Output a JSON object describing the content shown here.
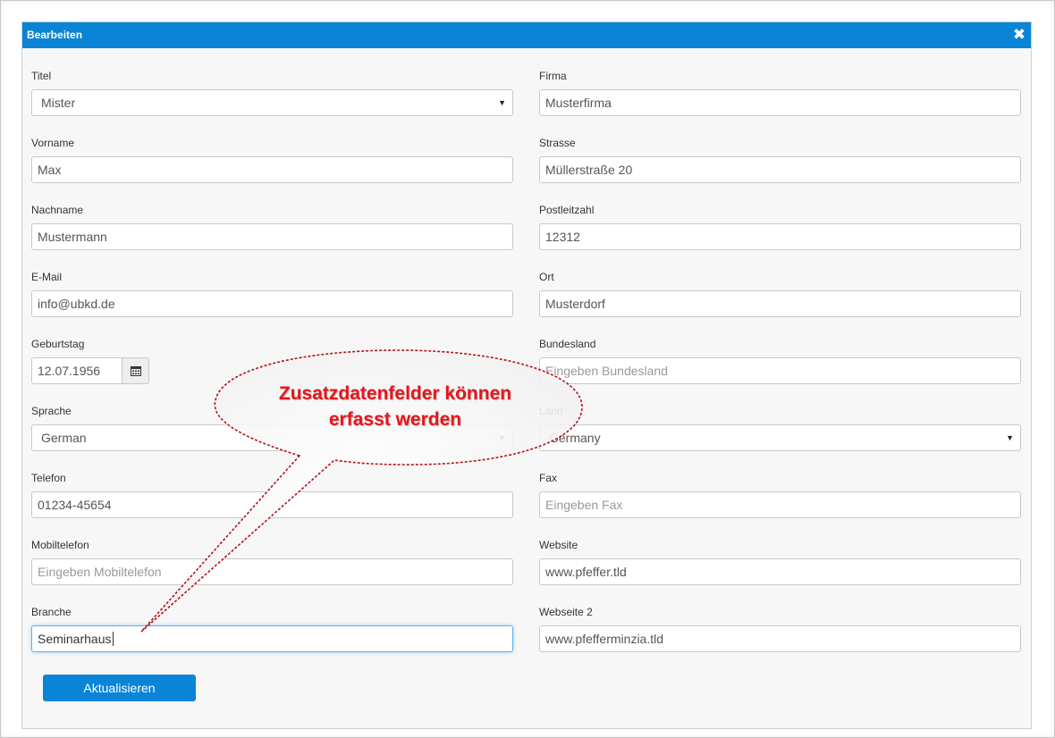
{
  "dialog": {
    "title": "Bearbeiten",
    "close_icon": "close-icon"
  },
  "form": {
    "titel": {
      "label": "Titel",
      "value": "Mister"
    },
    "vorname": {
      "label": "Vorname",
      "value": "Max"
    },
    "nachname": {
      "label": "Nachname",
      "value": "Mustermann"
    },
    "email": {
      "label": "E-Mail",
      "value": "info@ubkd.de"
    },
    "geburtstag": {
      "label": "Geburtstag",
      "value": "12.07.1956"
    },
    "sprache": {
      "label": "Sprache",
      "value": "German"
    },
    "telefon": {
      "label": "Telefon",
      "value": "01234-45654"
    },
    "mobiltelefon": {
      "label": "Mobiltelefon",
      "placeholder": "Eingeben Mobiltelefon"
    },
    "branche": {
      "label": "Branche",
      "value": "Seminarhaus"
    },
    "firma": {
      "label": "Firma",
      "value": "Musterfirma"
    },
    "strasse": {
      "label": "Strasse",
      "value": "Müllerstraße 20"
    },
    "postleitzahl": {
      "label": "Postleitzahl",
      "value": "12312"
    },
    "ort": {
      "label": "Ort",
      "value": "Musterdorf"
    },
    "bundesland": {
      "label": "Bundesland",
      "placeholder": "Eingeben Bundesland"
    },
    "land": {
      "label": "Land",
      "value": "Germany"
    },
    "fax": {
      "label": "Fax",
      "placeholder": "Eingeben Fax"
    },
    "website": {
      "label": "Website",
      "value": "www.pfeffer.tld"
    },
    "webseite2": {
      "label": "Webseite 2",
      "value": "www.pfefferminzia.tld"
    }
  },
  "actions": {
    "update_label": "Aktualisieren"
  },
  "annotation": {
    "line1": "Zusatzdatenfelder können",
    "line2": "erfasst werden",
    "color": "#e8141b"
  },
  "colors": {
    "accent": "#0a84d6"
  }
}
